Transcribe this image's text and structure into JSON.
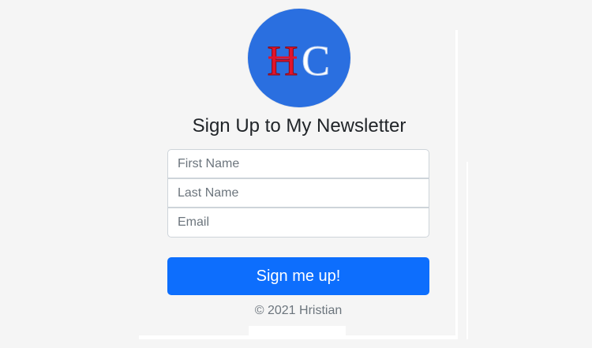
{
  "logo": {
    "letters": [
      "H",
      "C"
    ],
    "colors": {
      "background": "#2a6fe0",
      "first_letter": "#e1142c",
      "second_letter": "#ffffff"
    }
  },
  "heading": "Sign Up to My Newsletter",
  "form": {
    "first_name_placeholder": "First Name",
    "first_name_value": "",
    "last_name_placeholder": "Last Name",
    "last_name_value": "",
    "email_placeholder": "Email",
    "email_value": "",
    "submit_label": "Sign me up!"
  },
  "footer": "© 2021 Hristian",
  "colors": {
    "page_background": "#f5f5f5",
    "primary": "#0d6efd",
    "muted_text": "#6c757d"
  }
}
